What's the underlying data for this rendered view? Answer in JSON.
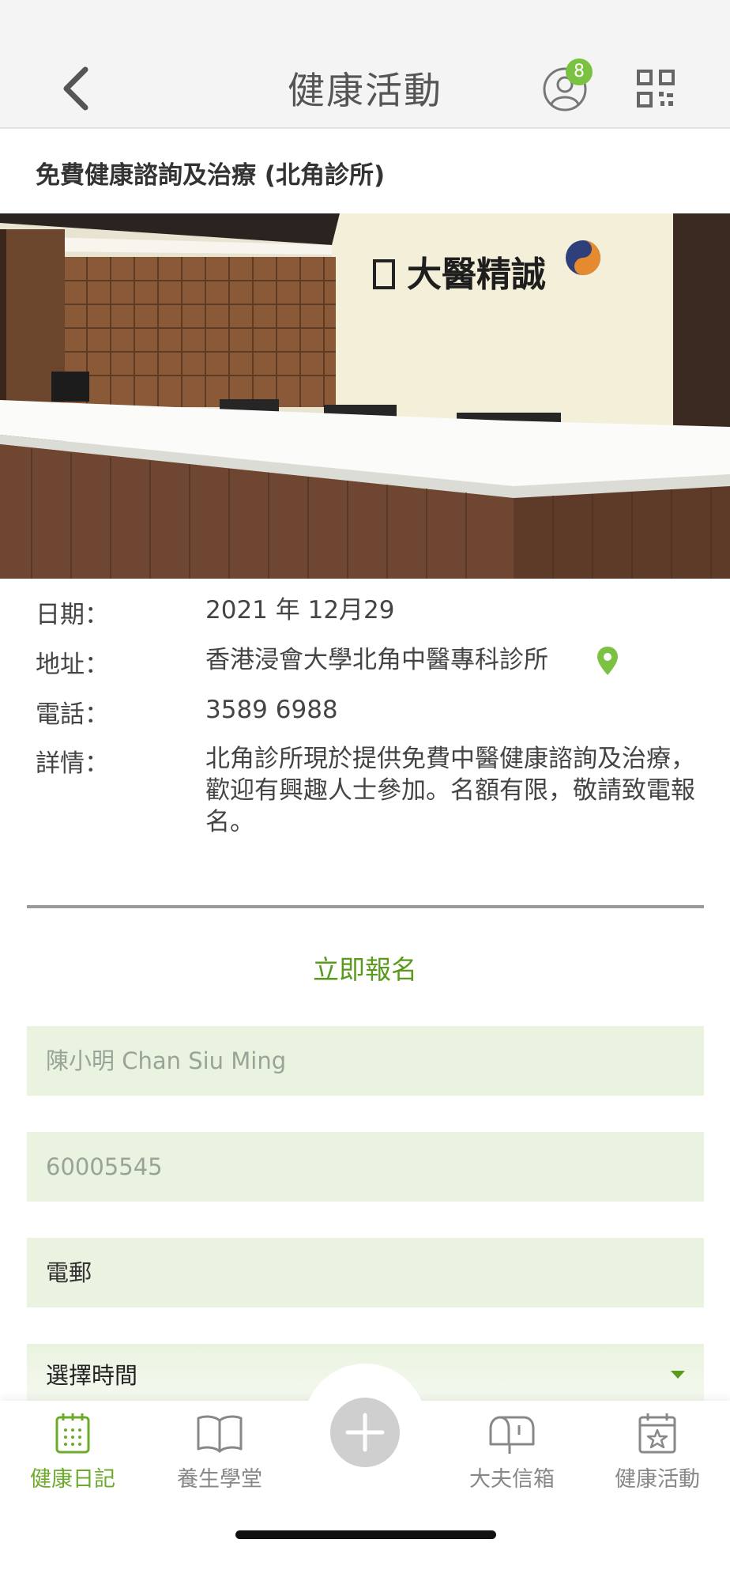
{
  "nav": {
    "title": "健康活動",
    "notification_count": "8"
  },
  "event": {
    "title": "免費健康諮詢及治療 (北角診所)",
    "photo_sign_text": "大醫精誠",
    "details": [
      {
        "label": "日期：",
        "value": "2021 年 12月29"
      },
      {
        "label": "地址：",
        "value": "香港浸會大學北角中醫專科診所"
      },
      {
        "label": "電話：",
        "value": "3589 6988"
      },
      {
        "label": "詳情：",
        "value": "北角診所現於提供免費中醫健康諮詢及治療，歡迎有興趣人士參加。名額有限，敬請致電報名。"
      }
    ]
  },
  "form": {
    "signup_label": "立即報名",
    "name_placeholder": "陳小明 Chan Siu Ming",
    "phone_placeholder": "60005545",
    "email_label": "電郵",
    "time_select_label": "選擇時間"
  },
  "tabs": [
    {
      "label": "健康日記",
      "icon": "diary-icon",
      "active": true
    },
    {
      "label": "養生學堂",
      "icon": "book-icon",
      "active": false
    },
    {
      "label": "大夫信箱",
      "icon": "mailbox-icon",
      "active": false
    },
    {
      "label": "健康活動",
      "icon": "calendar-star-icon",
      "active": false
    }
  ],
  "colors": {
    "accent": "#6cab2a",
    "field_bg": "#eaf3e0",
    "badge": "#7cc242"
  }
}
